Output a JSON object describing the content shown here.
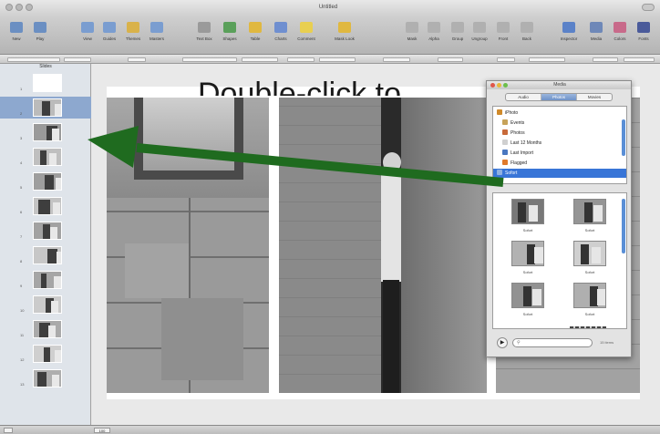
{
  "window": {
    "title": "Untitled"
  },
  "toolbar": {
    "items": [
      {
        "label": "New",
        "color": "#6b8fc2"
      },
      {
        "label": "Play",
        "color": "#6b8fc2"
      },
      {
        "label": "View",
        "color": "#7a9dd0"
      },
      {
        "label": "Guides",
        "color": "#7a9dd0"
      },
      {
        "label": "Themes",
        "color": "#d9b24a"
      },
      {
        "label": "Masters",
        "color": "#7a9dd0"
      },
      {
        "label": "Text Box",
        "color": "#9a9a9a"
      },
      {
        "label": "Shapes",
        "color": "#5aa05a"
      },
      {
        "label": "Table",
        "color": "#e0b840"
      },
      {
        "label": "Charts",
        "color": "#6f8fd0"
      },
      {
        "label": "Comment",
        "color": "#e8cf50"
      },
      {
        "label": "Mask Look",
        "color": "#e0b840"
      },
      {
        "label": "Mask",
        "color": "#b0b0b0"
      },
      {
        "label": "Alpha",
        "color": "#b0b0b0"
      },
      {
        "label": "Group",
        "color": "#b0b0b0"
      },
      {
        "label": "Ungroup",
        "color": "#b0b0b0"
      },
      {
        "label": "Front",
        "color": "#b0b0b0"
      },
      {
        "label": "Back",
        "color": "#b0b0b0"
      },
      {
        "label": "Inspector",
        "color": "#5b82c8"
      },
      {
        "label": "Media",
        "color": "#6e88b8"
      },
      {
        "label": "Colors",
        "color": "#c86a8a"
      },
      {
        "label": "Fonts",
        "color": "#4a5a9a"
      }
    ]
  },
  "navigator": {
    "header": "Slides",
    "slides": [
      {
        "number": "1",
        "selected": false
      },
      {
        "number": "2",
        "selected": true
      },
      {
        "number": "3",
        "selected": false
      },
      {
        "number": "4",
        "selected": false
      },
      {
        "number": "5",
        "selected": false
      },
      {
        "number": "6",
        "selected": false
      },
      {
        "number": "7",
        "selected": false
      },
      {
        "number": "8",
        "selected": false
      },
      {
        "number": "9",
        "selected": false
      },
      {
        "number": "10",
        "selected": false
      },
      {
        "number": "11",
        "selected": false
      },
      {
        "number": "12",
        "selected": false
      },
      {
        "number": "13",
        "selected": false
      }
    ]
  },
  "slide": {
    "title_placeholder": "Double-click to"
  },
  "status": {
    "zoom": "100"
  },
  "media_browser": {
    "title": "Media",
    "tabs": [
      {
        "label": "Audio",
        "active": false
      },
      {
        "label": "Photos",
        "active": true
      },
      {
        "label": "Movies",
        "active": false
      }
    ],
    "sources": [
      {
        "label": "iPhoto",
        "icon": "iphoto-icon",
        "color": "#d08a2a",
        "selected": false
      },
      {
        "label": "Events",
        "icon": "events-icon",
        "color": "#c7a35a",
        "selected": false
      },
      {
        "label": "Photos",
        "icon": "photos-icon",
        "color": "#c86a3a",
        "selected": false
      },
      {
        "label": "Last 12 Months",
        "icon": "calendar-icon",
        "color": "#d0d0d0",
        "selected": false
      },
      {
        "label": "Last Import",
        "icon": "import-icon",
        "color": "#4a78c0",
        "selected": false
      },
      {
        "label": "Flagged",
        "icon": "flag-icon",
        "color": "#e07a2a",
        "selected": false
      },
      {
        "label": "Sofort",
        "icon": "album-icon",
        "color": "#8fb0e0",
        "selected": true
      }
    ],
    "thumbnails": [
      {
        "caption": "Sofort"
      },
      {
        "caption": "Sofort"
      },
      {
        "caption": "Sofort"
      },
      {
        "caption": "Sofort"
      },
      {
        "caption": "Sofort"
      },
      {
        "caption": "Sofort"
      }
    ],
    "item_count": "15 items"
  },
  "colors": {
    "arrow": "#1f6b1f",
    "selection": "#3875d7"
  }
}
